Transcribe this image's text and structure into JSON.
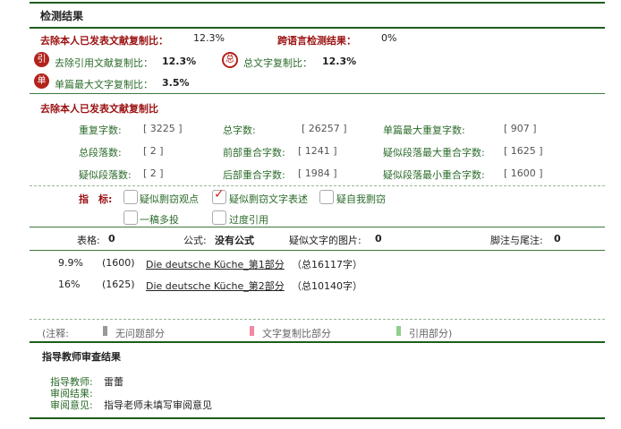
{
  "header": {
    "title": "检测结果"
  },
  "summary": {
    "exclude_self_label": "去除本人已发表文献复制比：",
    "exclude_self_value": "12.3%",
    "cross_lang_label": "跨语言检测结果：",
    "cross_lang_value": "0%",
    "exclude_ref_label": "去除引用文献复制比：",
    "exclude_ref_value": "12.3%",
    "total_label": "总文字复制比：",
    "total_value": "12.3%",
    "single_max_label": "单篇最大文字复制比：",
    "single_max_value": "3.5%",
    "badge_ref": "引",
    "badge_total": "总",
    "badge_single": "单"
  },
  "details": {
    "title": "去除本人已发表文献复制比",
    "rows": [
      [
        {
          "label": "重复字数:",
          "value": "[ 3225 ]"
        },
        {
          "label": "总字数:",
          "value": "[ 26257 ]"
        },
        {
          "label": "单篇最大重复字数:",
          "value": "[ 907 ]"
        }
      ],
      [
        {
          "label": "总段落数:",
          "value": "[ 2 ]"
        },
        {
          "label": "前部重合字数:",
          "value": "[ 1241 ]"
        },
        {
          "label": "疑似段落最大重合字数:",
          "value": "[ 1625 ]"
        }
      ],
      [
        {
          "label": "疑似段落数:",
          "value": "[ 2 ]"
        },
        {
          "label": "后部重合字数:",
          "value": "[ 1984 ]"
        },
        {
          "label": "疑似段落最小重合字数:",
          "value": "[ 1600 ]"
        }
      ]
    ]
  },
  "indicators": {
    "label": "指　标:",
    "options": [
      {
        "label": "疑似剽窃观点",
        "checked": false
      },
      {
        "label": "疑似剽窃文字表述",
        "checked": true
      },
      {
        "label": "疑自我剽窃",
        "checked": false
      },
      {
        "label": "一稿多投",
        "checked": false
      },
      {
        "label": "过度引用",
        "checked": false
      }
    ]
  },
  "stats": {
    "tables_label": "表格:",
    "tables_value": "0",
    "formulas_label": "公式:",
    "formulas_value": "没有公式",
    "images_label": "疑似文字的图片:",
    "images_value": "0",
    "footnotes_label": "脚注与尾注:",
    "footnotes_value": "0"
  },
  "sources": [
    {
      "percent": "9.9%",
      "count": "(1600)",
      "title": "Die deutsche Küche_第1部分",
      "total": "（总16117字）"
    },
    {
      "percent": "16%",
      "count": "(1625)",
      "title": "Die deutsche Küche_第2部分",
      "total": "（总10140字）"
    }
  ],
  "legend": {
    "note": "(注释:",
    "items": [
      {
        "label": "无问题部分",
        "color": "#999999"
      },
      {
        "label": "文字复制比部分",
        "color": "#f08aa0"
      },
      {
        "label": "引用部分)",
        "color": "#8fcf8f"
      }
    ]
  },
  "review": {
    "title": "指导教师审查结果",
    "teacher_label": "指导教师:",
    "teacher_value": "雷蕾",
    "result_label": "审阅结果:",
    "result_value": "",
    "opinion_label": "审阅意见:",
    "opinion_value": "指导老师未填写审阅意见"
  }
}
